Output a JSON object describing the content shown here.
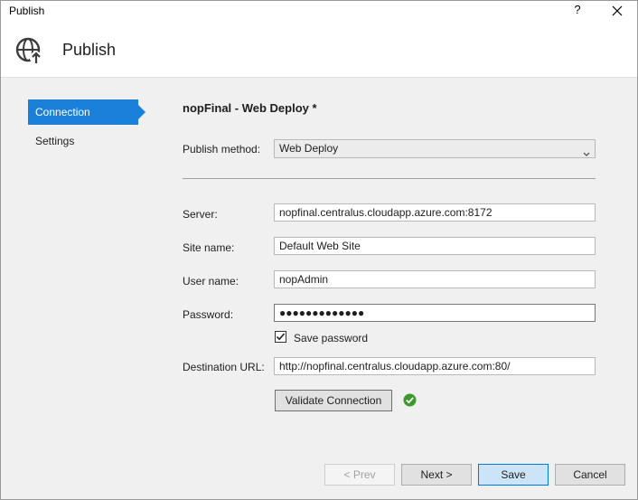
{
  "window": {
    "title": "Publish",
    "help_label": "?"
  },
  "header": {
    "title": "Publish",
    "icon": "globe-publish-icon"
  },
  "nav": {
    "items": [
      {
        "label": "Connection",
        "selected": true
      },
      {
        "label": "Settings",
        "selected": false
      }
    ]
  },
  "profile": {
    "title": "nopFinal - Web Deploy *"
  },
  "form": {
    "publish_method": {
      "label": "Publish method:",
      "value": "Web Deploy"
    },
    "server": {
      "label": "Server:",
      "value": "nopfinal.centralus.cloudapp.azure.com:8172"
    },
    "site_name": {
      "label": "Site name:",
      "value": "Default Web Site"
    },
    "user_name": {
      "label": "User name:",
      "value": "nopAdmin"
    },
    "password": {
      "label": "Password:",
      "value": "●●●●●●●●●●●●●"
    },
    "save_password": {
      "label": "Save password",
      "checked": true
    },
    "destination_url": {
      "label": "Destination URL:",
      "value": "http://nopfinal.centralus.cloudapp.azure.com:80/"
    },
    "validate_label": "Validate Connection",
    "validation_status": "success-check-icon"
  },
  "footer": {
    "prev_label": "< Prev",
    "next_label": "Next >",
    "save_label": "Save",
    "cancel_label": "Cancel"
  },
  "colors": {
    "accent": "#1b80d9",
    "success": "#3c9a2c",
    "save_button_bg": "#cce4f7"
  }
}
